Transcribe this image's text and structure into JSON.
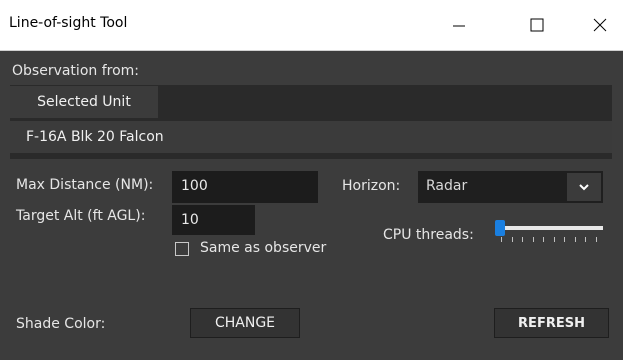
{
  "window": {
    "title": "Line-of-sight Tool",
    "controls": [
      "minimize",
      "maximize",
      "close"
    ]
  },
  "observation": {
    "section_label": "Observation from:",
    "tab_label": "Selected Unit",
    "unit_name": "F-16A Blk 20 Falcon"
  },
  "settings": {
    "max_distance_label": "Max Distance (NM):",
    "max_distance_value": "100",
    "target_alt_label": "Target Alt (ft AGL):",
    "target_alt_value": "10",
    "same_as_observer_label": "Same as observer",
    "same_as_observer_checked": false,
    "horizon_label": "Horizon:",
    "horizon_value": "Radar",
    "cpu_threads_label": "CPU threads:",
    "cpu_threads_level": 0
  },
  "shade": {
    "label": "Shade Color:",
    "change_label": "CHANGE"
  },
  "actions": {
    "refresh_label": "REFRESH"
  },
  "colors": {
    "background": "#3c3c3c",
    "accent": "#1a7fe0"
  }
}
